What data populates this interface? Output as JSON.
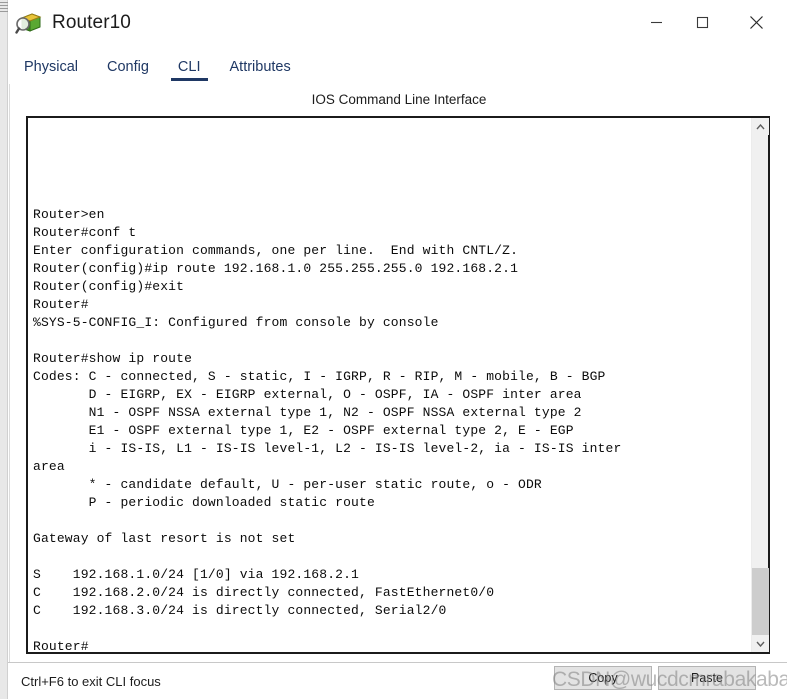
{
  "window": {
    "title": "Router10",
    "icon": "router-magnifier-icon",
    "controls": {
      "minimize": "minimize-icon",
      "maximize": "maximize-icon",
      "close": "close-icon"
    }
  },
  "tabs": [
    {
      "label": "Physical",
      "active": false
    },
    {
      "label": "Config",
      "active": false
    },
    {
      "label": "CLI",
      "active": true
    },
    {
      "label": "Attributes",
      "active": false
    }
  ],
  "panel": {
    "heading": "IOS Command Line Interface"
  },
  "terminal": {
    "lines": [
      "Router>en",
      "Router#conf t",
      "Enter configuration commands, one per line.  End with CNTL/Z.",
      "Router(config)#ip route 192.168.1.0 255.255.255.0 192.168.2.1",
      "Router(config)#exit",
      "Router#",
      "%SYS-5-CONFIG_I: Configured from console by console",
      "",
      "Router#show ip route",
      "Codes: C - connected, S - static, I - IGRP, R - RIP, M - mobile, B - BGP",
      "       D - EIGRP, EX - EIGRP external, O - OSPF, IA - OSPF inter area",
      "       N1 - OSPF NSSA external type 1, N2 - OSPF NSSA external type 2",
      "       E1 - OSPF external type 1, E2 - OSPF external type 2, E - EGP",
      "       i - IS-IS, L1 - IS-IS level-1, L2 - IS-IS level-2, ia - IS-IS inter",
      "area",
      "       * - candidate default, U - per-user static route, o - ODR",
      "       P - periodic downloaded static route",
      "",
      "Gateway of last resort is not set",
      "",
      "S    192.168.1.0/24 [1/0] via 192.168.2.1",
      "C    192.168.2.0/24 is directly connected, FastEthernet0/0",
      "C    192.168.3.0/24 is directly connected, Serial2/0",
      "",
      "Router#"
    ],
    "scrollbar": {
      "up_arrow": "chevron-up-icon",
      "down_arrow": "chevron-down-icon"
    }
  },
  "bottombar": {
    "status": "Ctrl+F6 to exit CLI focus",
    "copy_label": "Copy",
    "paste_label": "Paste"
  },
  "watermark": {
    "text": "CSDN@wucdcmrabakabaka"
  },
  "colors": {
    "tab_accent": "#1f3864",
    "terminal_border": "#1b1b1b",
    "scrollbar_thumb": "#cdcdcd",
    "button_face": "#e3e3e3"
  }
}
